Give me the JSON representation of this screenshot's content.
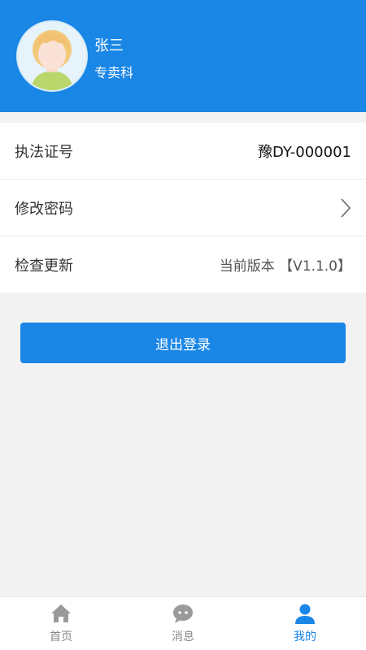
{
  "profile": {
    "name": "张三",
    "department": "专卖科"
  },
  "settings": {
    "license": {
      "label": "执法证号",
      "value": "豫DY-000001"
    },
    "password": {
      "label": "修改密码"
    },
    "update": {
      "label": "检查更新",
      "value": "当前版本 【V1.1.0】"
    }
  },
  "logout_label": "退出登录",
  "nav": {
    "items": [
      {
        "label": "首页",
        "icon": "home-icon",
        "active": false
      },
      {
        "label": "消息",
        "icon": "message-icon",
        "active": false
      },
      {
        "label": "我的",
        "icon": "user-icon",
        "active": true
      }
    ]
  },
  "colors": {
    "primary": "#1a86e6",
    "background": "#f2f2f2",
    "inactive_nav": "#888888"
  }
}
